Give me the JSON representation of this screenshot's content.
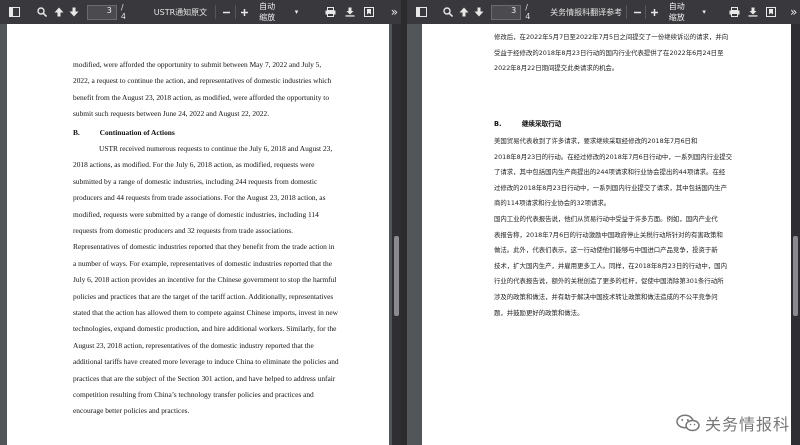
{
  "left": {
    "page_current": "3",
    "page_total": "/ 4",
    "title": "USTR通知原文",
    "zoom": "自动缩放",
    "paragraph1": [
      "modified, were afforded the opportunity to submit between May 7, 2022 and July 5,",
      "2022, a request to continue the action, and representatives of domestic industries which",
      "benefit from the August 23, 2018 action, as modified, were afforded the opportunity to",
      "submit such requests between June 24, 2022 and August 22, 2022."
    ],
    "heading_letter": "B.",
    "heading_text": "Continuation of Actions",
    "paragraph2": [
      "USTR received numerous requests to continue the July 6, 2018 and August 23,",
      "2018 actions, as modified. For the July 6, 2018 action, as modified, requests were",
      "submitted by a range of domestic industries, including 244 requests from domestic",
      "producers and 44 requests from trade associations. For the August 23, 2018 action, as",
      "modified, requests were submitted by a range of domestic industries, including 114",
      "requests from domestic producers and 32 requests from trade associations.",
      "Representatives of domestic industries reported that they benefit from the trade action in",
      "a number of ways. For example, representatives of domestic industries  reported that the",
      "July 6, 2018 action provides an incentive for the Chinese government to stop the harmful",
      "policies and practices that are the target of the tariff action. Additionally, representatives",
      "stated that the action has allowed them to compete against Chinese imports, invest in new",
      "technologies, expand domestic production, and hire additional workers. Similarly, for the",
      "August 23, 2018 action, representatives of the domestic industry reported that the",
      "additional tariffs have created more leverage to induce China to eliminate the policies and",
      "practices that are the subject of the Section 301 action, and have helped to address unfair",
      "competition resulting from China’s technology transfer policies and practices and",
      "encourage better policies and practices."
    ]
  },
  "right": {
    "page_current": "3",
    "page_total": "/ 4",
    "title": "关务情报科翻译参考",
    "zoom": "自动缩放",
    "paragraph1": [
      "修改后，在2022年5月7日至2022年7月5日之间提交了一份继续诉讼的请求，并向",
      "受益于经修改的2018年8月23日行动的国内行业代表提供了在2022年6月24日至",
      "2022年8月22日期间提交此类请求的机会。"
    ],
    "heading_letter": "B.",
    "heading_text": "继续采取行动",
    "paragraph2": [
      "        美国贸易代表收到了许多请求，要求继续采取经修改的2018年7月6日和",
      "2018年8月23日的行动。在经过修改的2018年7月6日行动中，一系列国内行业提交",
      "了请求，其中包括国内生产商提出的244项请求和行业协会提出的44项请求。在经",
      "过修改的2018年8月23日行动中，一系列国内行业提交了请求，其中包括国内生产",
      "商的114项请求和行业协会的32项请求。",
      "国内工业的代表报告说，他们从贸易行动中受益于许多方面。例如，国内产业代",
      "表报告称，2018年7月6日的行动激励中国政府停止关税行动所针对的有害政策和",
      "做法。此外，代表们表示，这一行动使他们能够与中国进口产品竞争，投资于新",
      "技术，扩大国内生产，并雇用更多工人。同样，在2018年8月23日的行动中，国内",
      "行业的代表报告说，额外的关税创造了更多的杠杆，促使中国消除第301条行动所",
      "涉及的政策和做法，并有助于解决中国技术转让政策和做法造成的不公平竞争问",
      "题，并鼓励更好的政策和做法。"
    ]
  },
  "watermark": {
    "text": "关务情报科",
    "icon": "wechat-icon"
  },
  "colors": {
    "toolbar": "#38383d",
    "viewer_bg": "#525659",
    "page": "#ffffff"
  }
}
